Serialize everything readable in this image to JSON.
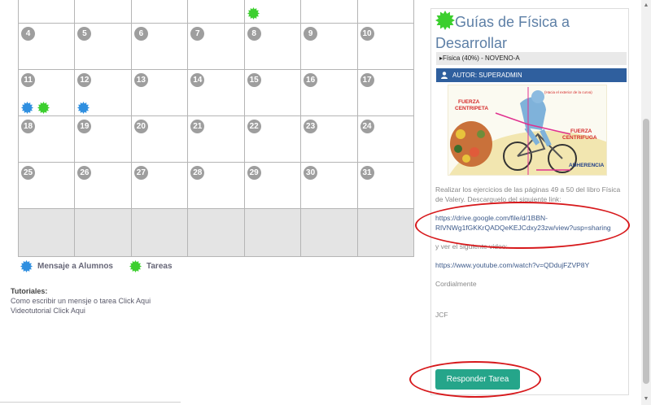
{
  "calendar": {
    "weeks": [
      {
        "days": [
          {
            "num": "",
            "markers": []
          },
          {
            "num": "",
            "markers": []
          },
          {
            "num": "",
            "markers": []
          },
          {
            "num": "",
            "markers": []
          },
          {
            "num": "",
            "markers": [
              "tarea"
            ]
          },
          {
            "num": "",
            "markers": []
          },
          {
            "num": "",
            "markers": []
          }
        ]
      },
      {
        "days": [
          {
            "num": "4",
            "markers": []
          },
          {
            "num": "5",
            "markers": []
          },
          {
            "num": "6",
            "markers": []
          },
          {
            "num": "7",
            "markers": []
          },
          {
            "num": "8",
            "markers": []
          },
          {
            "num": "9",
            "markers": []
          },
          {
            "num": "10",
            "markers": []
          }
        ]
      },
      {
        "days": [
          {
            "num": "11",
            "markers": [
              "mensaje",
              "tarea"
            ]
          },
          {
            "num": "12",
            "markers": [
              "mensaje"
            ]
          },
          {
            "num": "13",
            "markers": []
          },
          {
            "num": "14",
            "markers": []
          },
          {
            "num": "15",
            "markers": []
          },
          {
            "num": "16",
            "markers": []
          },
          {
            "num": "17",
            "markers": []
          }
        ]
      },
      {
        "days": [
          {
            "num": "18",
            "markers": []
          },
          {
            "num": "19",
            "markers": []
          },
          {
            "num": "20",
            "markers": []
          },
          {
            "num": "21",
            "markers": []
          },
          {
            "num": "22",
            "markers": []
          },
          {
            "num": "23",
            "markers": []
          },
          {
            "num": "24",
            "markers": []
          }
        ]
      },
      {
        "days": [
          {
            "num": "25",
            "markers": []
          },
          {
            "num": "26",
            "markers": []
          },
          {
            "num": "27",
            "markers": []
          },
          {
            "num": "28",
            "markers": []
          },
          {
            "num": "29",
            "markers": []
          },
          {
            "num": "30",
            "markers": []
          },
          {
            "num": "31",
            "markers": []
          }
        ]
      }
    ]
  },
  "legend": {
    "mensaje_label": "Mensaje a Alumnos",
    "tarea_label": "Tareas",
    "mensaje_color": "#2f8fe0",
    "tarea_color": "#3ccf2e"
  },
  "tutorials": {
    "title": "Tutoriales:",
    "link1": "Como escribir un mensje o tarea Click Aqui",
    "link2": "Videotutorial Click Aqui"
  },
  "panel": {
    "title": "Guías de Física a Desarrollar",
    "title_icon": "green-burst-icon",
    "subject": "▸Física (40%) - NOVENO-A",
    "author": "AUTOR: SUPERADMIN",
    "author_icon": "user-icon",
    "image": {
      "label_centripeta": "FUERZA CENTRIPETA",
      "label_exterior": "(Hacia el exterior de la curva)",
      "label_centrifuga": "FUERZA CENTRIFUGA",
      "label_adherencia": "ADHERENCIA"
    },
    "body": {
      "p1": "Realizar los ejercicios de las páginas 49 a 50 del libro Física de Valery. Descarguelo del siguiente link:",
      "drive_link": "https://drive.google.com/file/d/1BBN-RlVNWg1fGKKrQADQeKEJCdxy23zw/view?usp=sharing",
      "p2": "y ver el siguiente video:",
      "youtube_link": "https://www.youtube.com/watch?v=QDdujFZVP8Y",
      "closing": "Cordialmente",
      "signature": "JCF"
    },
    "reply_button": "Responder Tarea",
    "annotation_color": "#d7191c"
  }
}
